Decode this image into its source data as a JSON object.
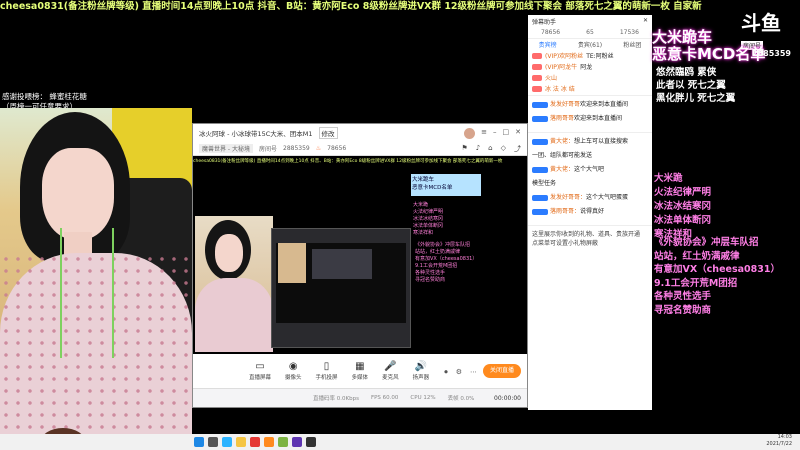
{
  "ticker": "cheesa0831(备注粉丝牌等级)  直播时间14点到晚上10点 抖音、B站：黄亦阿Eco 8级粉丝牌进VX群 12级粉丝牌可参加线下聚会 部落死七之翼的萌新一枚  自家新",
  "overlay_left": [
    "感谢投喂榜： 蜂蜜桂花糖",
    "（周榜一可任意要求）"
  ],
  "window": {
    "title": "冰火阿球 - 小冰球带15C大米、团本M1",
    "edit_label": "修改",
    "category_tag": "魔兽世界 - 大秘境",
    "room_id_label": "房间号",
    "room_id": "2885359",
    "heat": "78656",
    "preview_ticker": "cheesa0831(备注粉丝牌等级)  直播时间14点到晚上10点 抖音、B站：黄亦阿Eco 8级粉丝牌进VX群 12级粉丝牌可参加线下聚会 部落死七之翼的萌新一枚",
    "preview_right_lines": [
      "大米跪",
      "火法纪律严明",
      "冰法冰结寒冈",
      "冰法单体断冈",
      "寒法祥和"
    ],
    "preview_chat_lines": [
      "《外貌协会》冲层车队招",
      "站站，红土奶满戚律",
      "有意加VX（cheesa0831）",
      "9.1工会开荒M团招",
      "各种灵性选手",
      "寻冠名赞助商"
    ],
    "toolbar": [
      {
        "label": "直播屏幕",
        "icon": "▭"
      },
      {
        "label": "摄像头",
        "icon": "◉"
      },
      {
        "label": "手机投屏",
        "icon": "▯"
      },
      {
        "label": "多媒体",
        "icon": "▦"
      },
      {
        "label": "麦克风",
        "icon": "🎤"
      },
      {
        "label": "扬声器",
        "icon": "🔊"
      }
    ],
    "go_live": "关闭直播",
    "status_items": [
      "直播码率 0.0Kbps",
      "FPS 60.00",
      "CPU 12%",
      "丢帧 0.0%"
    ],
    "time": "00:00:00"
  },
  "panel": {
    "title": "弹幕助手",
    "stats": [
      "78656",
      "65",
      "17536"
    ],
    "tabs": [
      "贵宾榜",
      "贵宾(61)",
      "粉丝团"
    ],
    "ranks": [
      {
        "user": "(VIP)欢阿粉丝",
        "text": "TE:阿粉丝"
      },
      {
        "user": "(VIP)阿龙牛",
        "text": "阿龙"
      },
      {
        "user": "火山",
        "text": ""
      },
      {
        "user": "冰 法 冰 结",
        "text": ""
      }
    ],
    "notices": [
      {
        "name": "发发好哥哥",
        "text": "欢迎来到本直播间"
      },
      {
        "name": "落雨哥哥",
        "text": "欢迎来到本直播间"
      }
    ],
    "chat": [
      {
        "name": "黄大佬：",
        "text": "想上车可以直接搜索"
      },
      {
        "name": "",
        "text": "一团、组队都可能发送"
      },
      {
        "name": "黄大佬：",
        "text": "这个大气吧"
      },
      {
        "name": "",
        "text": "模型任务"
      },
      {
        "name": "发发好哥哥：",
        "text": "这个大气吧蛋蛋"
      },
      {
        "name": "落雨哥哥：",
        "text": "说得真好"
      }
    ],
    "system": [
      "这里展示你收到的礼物、道具、贵族开通",
      "点菜单可设置小礼物屏蔽"
    ]
  },
  "logo": {
    "glyph": "斗鱼",
    "room_label": "房间号",
    "room_number": "2885359"
  },
  "big_pink": [
    "大米跪车",
    "恶意卡MCD名单"
  ],
  "sub_lines": [
    "悠然臨鸥  累侠",
    "此者以 死七之翼",
    "黑化胖儿  死七之翼"
  ],
  "pink_list": [
    "大米跪",
    "火法纪律严明",
    "冰法冰结寒冈",
    "冰法单体断冈",
    "寒法祥和"
  ],
  "pink_list2": [
    "《外貌协会》冲层车队招",
    "站站，红土奶满戚律",
    "有意加VX（cheesa0831）",
    "9.1工会开荒M团招",
    "各种灵性选手",
    "寻冠名赞助商"
  ],
  "clock": {
    "time": "14:03",
    "date": "2021/7/22"
  },
  "colors": {
    "accent": "#ff8a1e",
    "pink": "#ff7fe6",
    "ticker": "#e6ff7a",
    "link": "#2b7cff"
  }
}
